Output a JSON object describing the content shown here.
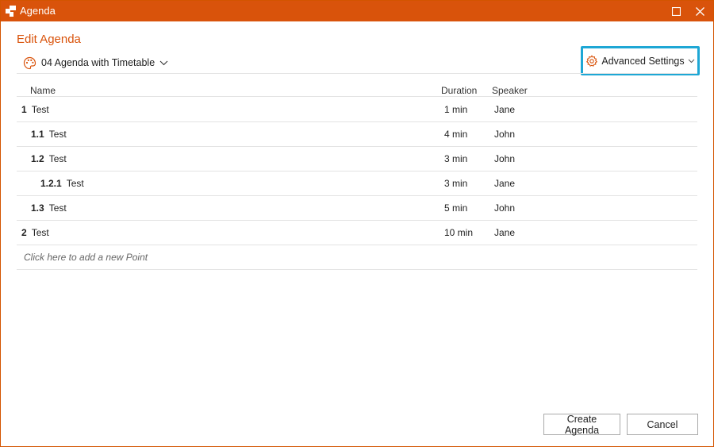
{
  "window": {
    "title": "Agenda",
    "accent_color": "#d9530b",
    "highlight_color": "#1ea7d5"
  },
  "header": {
    "heading": "Edit Agenda",
    "template_label": "04 Agenda with Timetable",
    "advanced_settings_label": "Advanced Settings"
  },
  "table": {
    "columns": {
      "name": "Name",
      "duration": "Duration",
      "speaker": "Speaker"
    },
    "rows": [
      {
        "number": "1",
        "name": "Test",
        "duration": "1 min",
        "speaker": "Jane"
      },
      {
        "number": "1.1",
        "name": "Test",
        "duration": "4 min",
        "speaker": "John"
      },
      {
        "number": "1.2",
        "name": "Test",
        "duration": "3 min",
        "speaker": "John"
      },
      {
        "number": "1.2.1",
        "name": "Test",
        "duration": "3 min",
        "speaker": "Jane"
      },
      {
        "number": "1.3",
        "name": "Test",
        "duration": "5 min",
        "speaker": "John"
      },
      {
        "number": "2",
        "name": "Test",
        "duration": "10 min",
        "speaker": "Jane"
      }
    ],
    "add_point_placeholder": "Click here to add a new Point"
  },
  "footer": {
    "create_label": "Create Agenda",
    "cancel_label": "Cancel"
  },
  "icons": {
    "app": "agenda-app-icon",
    "maximize": "maximize-icon",
    "close": "close-icon",
    "palette": "palette-icon",
    "gear": "gear-icon",
    "chevron": "chevron-down-icon"
  }
}
